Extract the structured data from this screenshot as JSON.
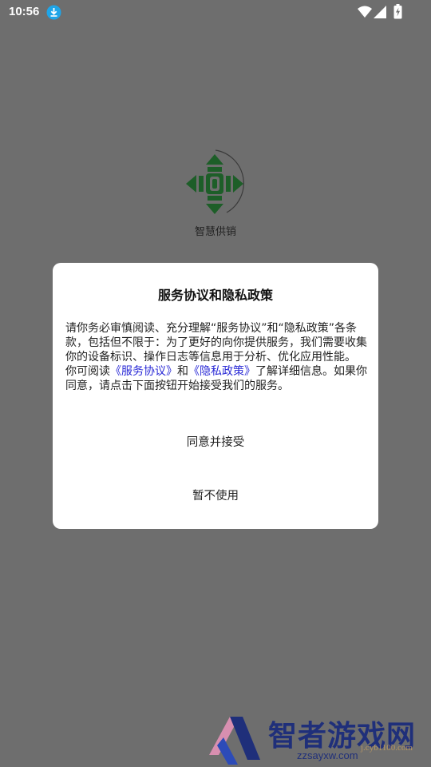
{
  "status_bar": {
    "time": "10:56",
    "notification_icon": "download-icon",
    "icons": [
      "wifi-icon",
      "signal-icon",
      "battery-charging-icon"
    ]
  },
  "splash": {
    "logo_icon": "gamepad-dpad-logo",
    "app_name": "智慧供销"
  },
  "dialog": {
    "title": "服务协议和隐私政策",
    "body_p1": "请你务必审慎阅读、充分理解“服务协议”和“隐私政策”各条款，包括但不限于：为了更好的向你提供服务，我们需要收集你的设备标识、操作日志等信息用于分析、优化应用性能。",
    "body_p2_pre": "你可阅读",
    "link_service": "《服务协议》",
    "body_p2_and": "和",
    "link_privacy": "《隐私政策》",
    "body_p2_post": "了解详细信息。如果你同意，请点击下面按钮开始接受我们的服务。",
    "accept_label": "同意并接受",
    "decline_label": "暂不使用"
  },
  "watermark": {
    "brand": "智者游戏网",
    "url": "zzsayxw.com",
    "faint": "j.cyb1100.com"
  },
  "colors": {
    "overlay_background": "#6e6e6e",
    "dialog_background": "#ffffff",
    "link": "#2a2ad6",
    "logo_green": "#1d5e28",
    "watermark_blue": "#1f2f7a"
  }
}
